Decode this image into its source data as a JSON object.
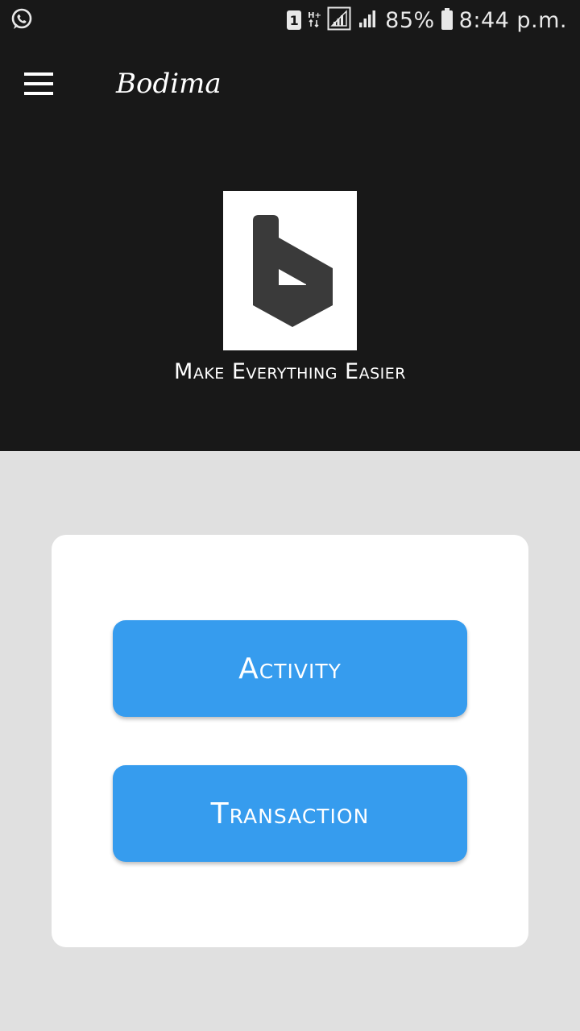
{
  "status_bar": {
    "left_icon": "whatsapp-icon",
    "sim_label": "1",
    "network_type": "H+",
    "battery_percent": "85%",
    "time": "8:44 p.m."
  },
  "app_bar": {
    "title": "Bodima",
    "menu_icon": "hamburger-menu-icon"
  },
  "hero": {
    "logo_icon": "bodima-logo-icon",
    "tagline": "Make Everything Easier"
  },
  "card": {
    "buttons": [
      {
        "label": "Activity"
      },
      {
        "label": "Transaction"
      }
    ]
  },
  "colors": {
    "header_bg": "#181818",
    "page_bg": "#e0e0e0",
    "button_bg": "#369cee",
    "logo_fill": "#3a3a3a"
  }
}
